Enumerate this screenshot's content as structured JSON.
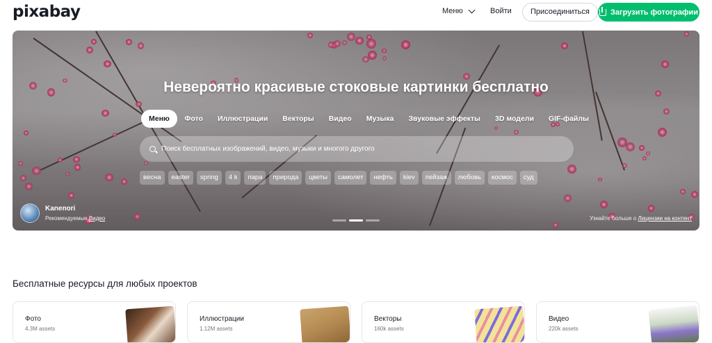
{
  "header": {
    "logo": "pixabay",
    "menu_label": "Меню",
    "login_label": "Войти",
    "join_label": "Присоединиться",
    "upload_label": "Загрузить фотографии"
  },
  "hero": {
    "title": "Невероятно красивые стоковые картинки бесплатно",
    "tabs": [
      {
        "label": "Меню",
        "active": true
      },
      {
        "label": "Фото"
      },
      {
        "label": "Иллюстрации"
      },
      {
        "label": "Векторы"
      },
      {
        "label": "Видео"
      },
      {
        "label": "Музыка"
      },
      {
        "label": "Звуковые эффекты"
      },
      {
        "label": "3D модели"
      },
      {
        "label": "GIF-файлы"
      }
    ],
    "search_placeholder": "Поиск бесплатных изображений, видео, музыки и многого другого",
    "chips": [
      "весна",
      "easter",
      "spring",
      "4 k",
      "пара",
      "природа",
      "цветы",
      "самолет",
      "нефть",
      "kiev",
      "пейзаж",
      "любовь",
      "космос",
      "суд"
    ],
    "credit_name": "Kanenori",
    "credit_prefix": "Рекомендуемые",
    "credit_link": "Видео",
    "license_prefix": "Узнайте больше о",
    "license_link": "Лицензии на контент"
  },
  "section": {
    "title": "Бесплатные ресурсы для любых проектов",
    "cards": [
      {
        "title": "Фото",
        "count": "4.3M assets"
      },
      {
        "title": "Иллюстрации",
        "count": "1.12M assets"
      },
      {
        "title": "Векторы",
        "count": "160k assets"
      },
      {
        "title": "Видео",
        "count": "220k assets"
      }
    ]
  },
  "colors": {
    "accent": "#02be6e",
    "text": "#191b26"
  }
}
